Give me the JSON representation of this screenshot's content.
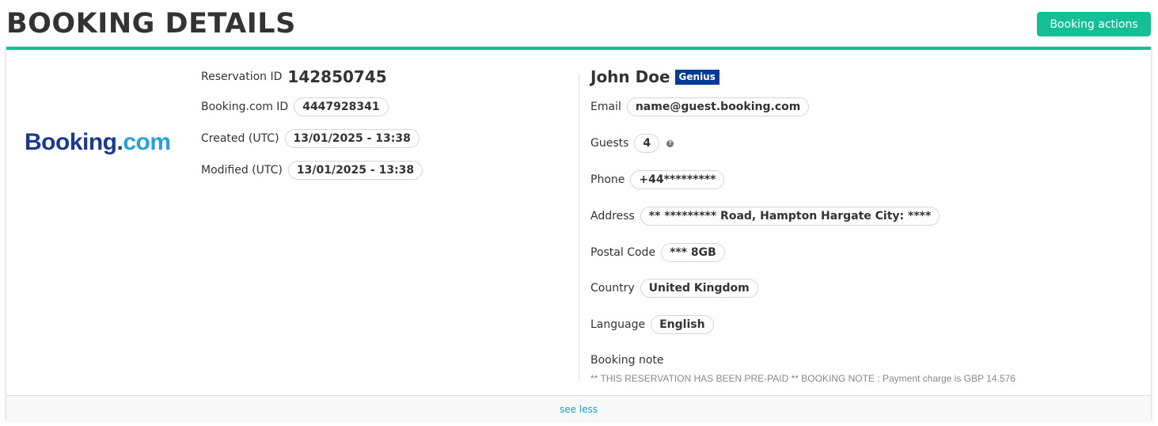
{
  "page": {
    "title": "BOOKING DETAILS",
    "actions_label": "Booking actions"
  },
  "colors": {
    "accent": "#14bf95",
    "genius_badge": "#003b95",
    "link": "#1a9fc4"
  },
  "logo": {
    "part1": "Booking",
    "part2": ".",
    "part3": "com"
  },
  "reservation": {
    "reservation_id_label": "Reservation ID",
    "reservation_id": "142850745",
    "booking_id_label": "Booking.com ID",
    "booking_id": "4447928341",
    "created_label": "Created (UTC)",
    "created": "13/01/2025 - 13:38",
    "modified_label": "Modified (UTC)",
    "modified": "13/01/2025 - 13:38"
  },
  "guest": {
    "name": "John Doe",
    "badge": "Genius",
    "email_label": "Email",
    "email": "name@guest.booking.com",
    "guests_label": "Guests",
    "guests": "4",
    "phone_label": "Phone",
    "phone": "+44*********",
    "address_label": "Address",
    "address": "** ********* Road, Hampton Hargate City: ****",
    "postal_label": "Postal Code",
    "postal": "*** 8GB",
    "country_label": "Country",
    "country": "United Kingdom",
    "language_label": "Language",
    "language": "English",
    "note_label": "Booking note",
    "note": "** THIS RESERVATION HAS BEEN PRE-PAID ** BOOKING NOTE : Payment charge is GBP 14.576",
    "help_icon": "question-icon"
  },
  "footer": {
    "see_less": "see less"
  }
}
